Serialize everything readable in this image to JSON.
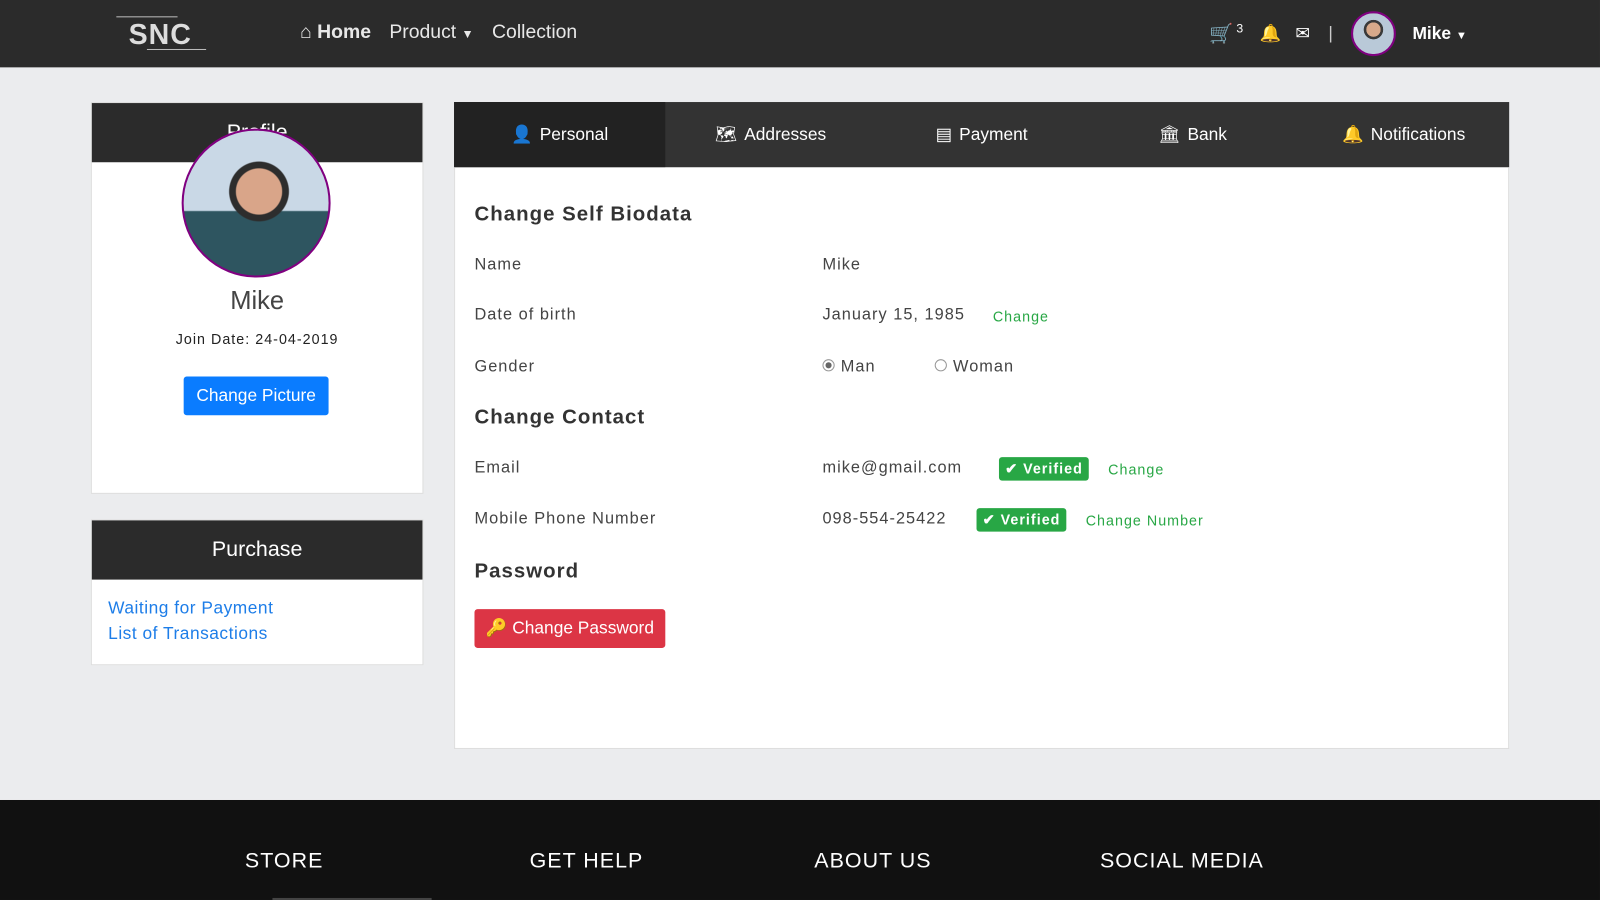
{
  "nav": {
    "logo": "SNC",
    "home": "Home",
    "product": "Product",
    "collection": "Collection",
    "cart_count": "3",
    "separator": "|",
    "user": "Mike"
  },
  "profile": {
    "title": "Profile",
    "name": "Mike",
    "join_date": "Join Date: 24-04-2019",
    "change_picture": "Change Picture"
  },
  "purchase": {
    "title": "Purchase",
    "links": [
      "Waiting for Payment",
      "List of Transactions"
    ]
  },
  "tabs": [
    "Personal",
    "Addresses",
    "Payment",
    "Bank",
    "Notifications"
  ],
  "biodata": {
    "title": "Change Self Biodata",
    "name_label": "Name",
    "name": "Mike",
    "dob_label": "Date of birth",
    "dob": "January 15, 1985",
    "dob_change": "Change",
    "gender_label": "Gender",
    "gender_options": [
      "Man",
      "Woman"
    ],
    "gender_selected": "Man"
  },
  "contact": {
    "title": "Change Contact",
    "email_label": "Email",
    "email": "mike@gmail.com",
    "email_status": "Verified",
    "email_change": "Change",
    "phone_label": "Mobile Phone Number",
    "phone": "098-554-25422",
    "phone_status": "Verified",
    "phone_change": "Change Number"
  },
  "password": {
    "title": "Password",
    "button": "Change Password"
  },
  "footer": [
    "STORE",
    "GET HELP",
    "ABOUT US",
    "SOCIAL MEDIA"
  ]
}
